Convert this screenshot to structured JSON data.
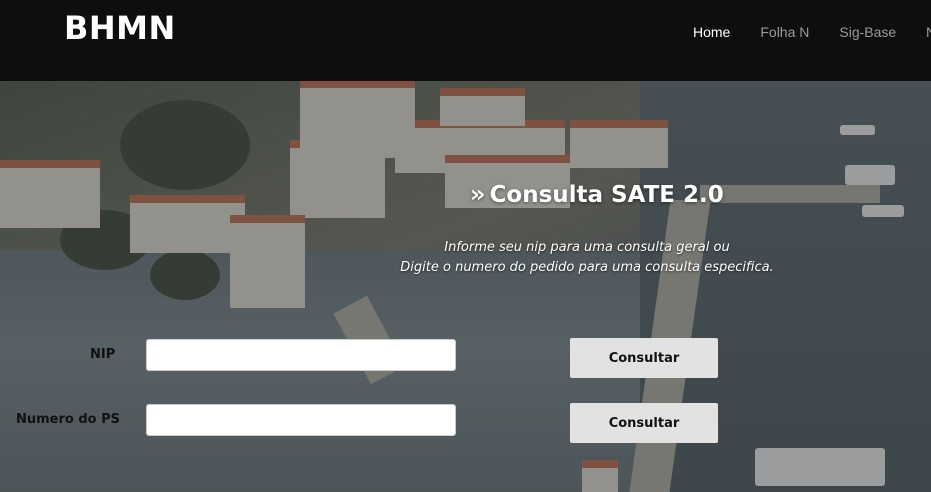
{
  "navbar": {
    "brand": "BHMN",
    "items": [
      {
        "label": "Home",
        "active": true
      },
      {
        "label": "Folha N",
        "active": false
      },
      {
        "label": "Sig-Base",
        "active": false
      }
    ],
    "overflow_label": "N"
  },
  "main": {
    "heading_icon": "»",
    "heading": "Consulta SATE 2.0",
    "subtitle_line1": "Informe seu nip para uma consulta geral ou",
    "subtitle_line2": "Digite o numero do pedido para uma consulta especifica."
  },
  "form": {
    "nip": {
      "label": "NIP",
      "value": "",
      "button": "Consultar"
    },
    "ps": {
      "label": "Numero do PS",
      "value": "",
      "button": "Consultar"
    }
  }
}
